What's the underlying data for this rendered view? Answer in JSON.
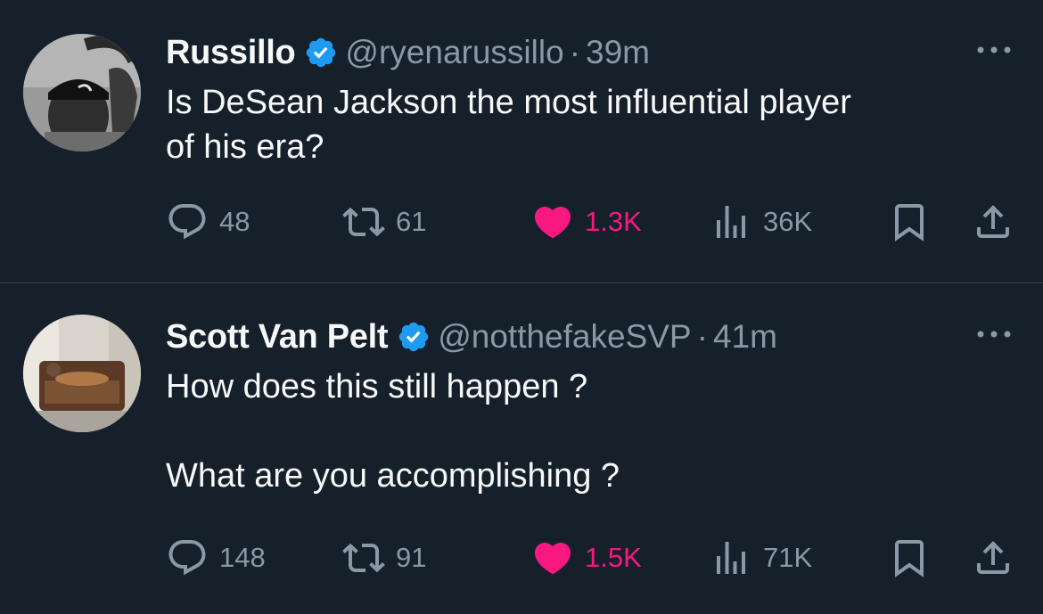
{
  "tweets": [
    {
      "name": "Russillo",
      "handle": "@ryenarussillo",
      "separator": "·",
      "time": "39m",
      "text": "Is DeSean Jackson the most influential player\nof his era?",
      "replies": "48",
      "retweets": "61",
      "likes": "1.3K",
      "views": "36K"
    },
    {
      "name": "Scott Van Pelt",
      "handle": "@notthefakeSVP",
      "separator": "·",
      "time": "41m",
      "text": "How does this still happen ?\n\nWhat are you accomplishing ?",
      "replies": "148",
      "retweets": "91",
      "likes": "1.5K",
      "views": "71K"
    }
  ],
  "colors": {
    "background": "#15202b",
    "divider": "#38444d",
    "text_primary": "#f7f9f9",
    "text_secondary": "#8b98a5",
    "verified_blue": "#1d9bf0",
    "like_pink": "#f91880"
  },
  "icons": [
    "verified-badge-icon",
    "more-icon",
    "reply-icon",
    "retweet-icon",
    "heart-icon",
    "views-icon",
    "bookmark-icon",
    "share-icon"
  ]
}
